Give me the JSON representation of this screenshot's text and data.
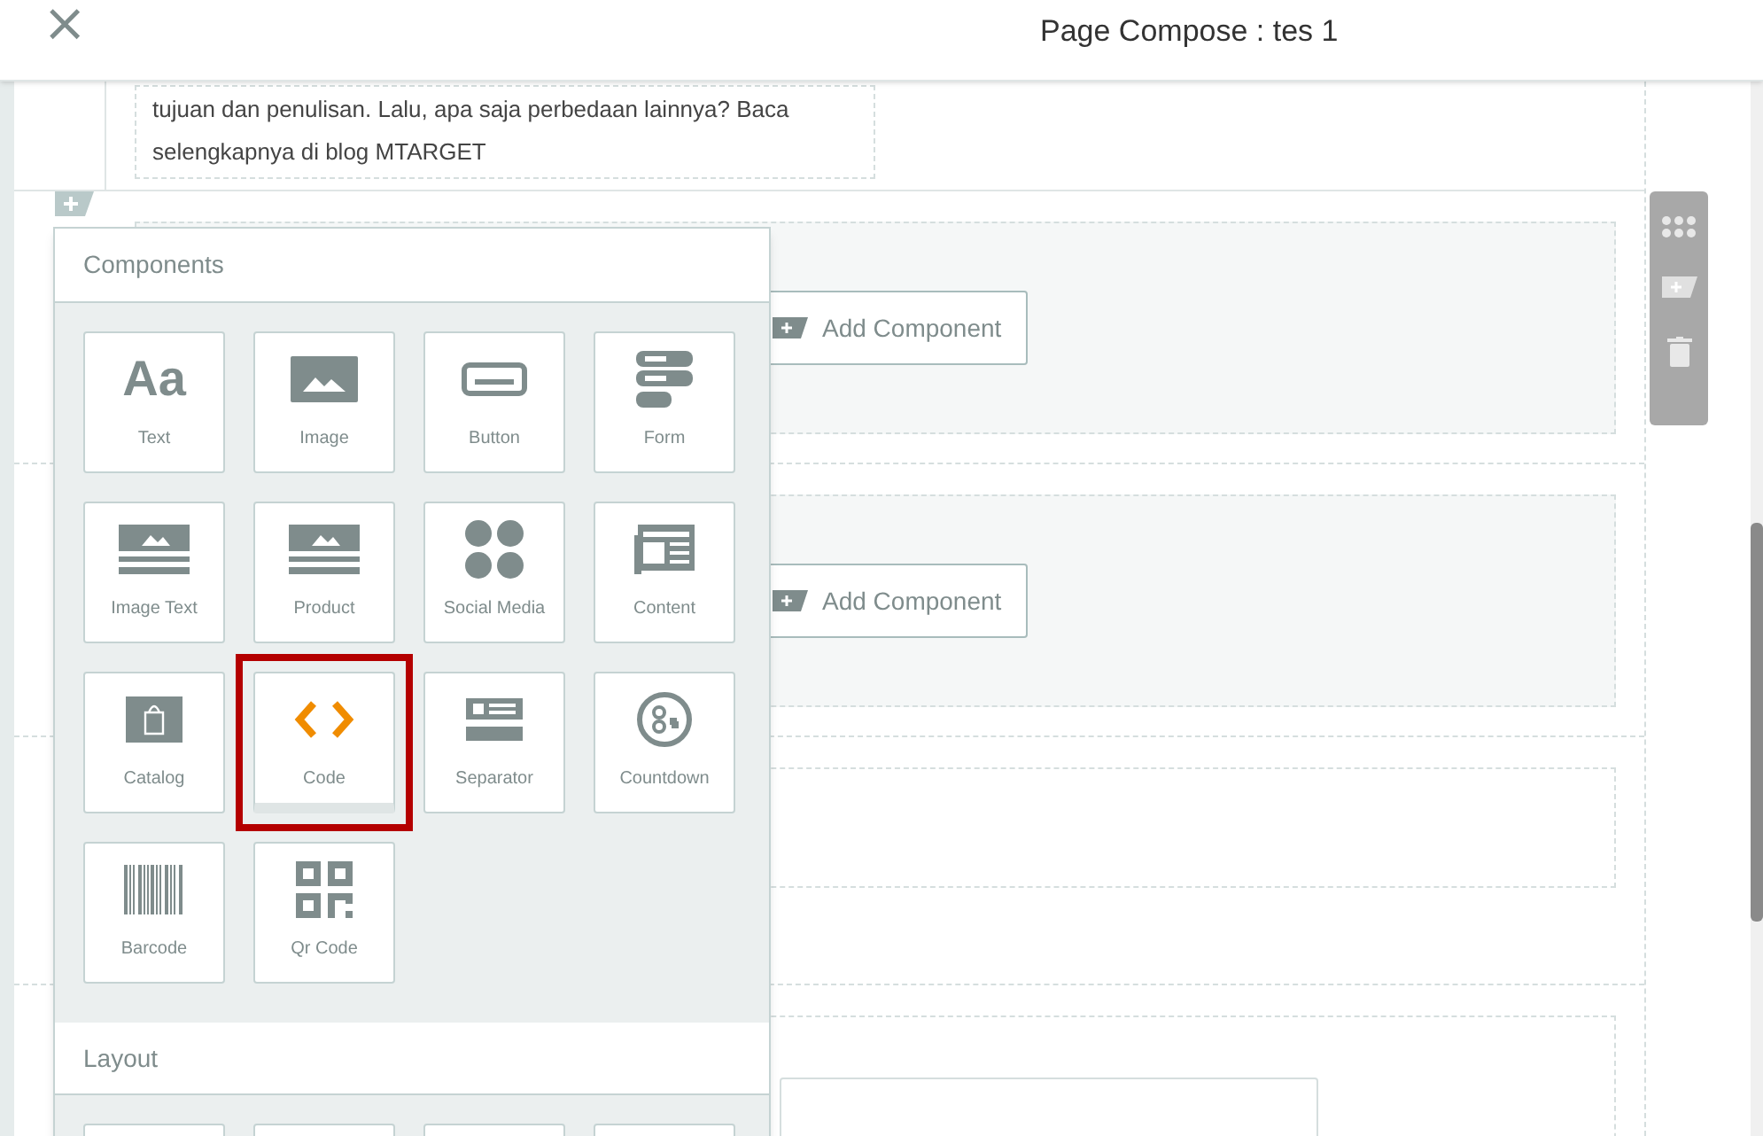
{
  "header": {
    "close": "×",
    "title": "Page Compose : tes 1"
  },
  "text_block": {
    "lines": [
      "tujuan dan penulisan. Lalu, apa saja perbedaan lainnya? Baca",
      "selengkapnya di blog MTARGET"
    ]
  },
  "sections": [
    {
      "kind": "add",
      "button": "Add Component"
    },
    {
      "kind": "add",
      "button": "Add Component"
    },
    {
      "kind": "empty"
    },
    {
      "kind": "field"
    }
  ],
  "popup": {
    "components_title": "Components",
    "components": [
      {
        "kind": "text",
        "label": "Text",
        "glyph": "Aa",
        "selected": false
      },
      {
        "kind": "image",
        "label": "Image",
        "selected": false
      },
      {
        "kind": "button",
        "label": "Button",
        "selected": false
      },
      {
        "kind": "form",
        "label": "Form",
        "selected": false
      },
      {
        "kind": "imagetext",
        "label": "Image Text",
        "selected": false
      },
      {
        "kind": "product",
        "label": "Product",
        "selected": false
      },
      {
        "kind": "social",
        "label": "Social Media",
        "selected": false
      },
      {
        "kind": "content",
        "label": "Content",
        "selected": false
      },
      {
        "kind": "catalog",
        "label": "Catalog",
        "selected": false
      },
      {
        "kind": "code",
        "label": "Code",
        "selected": true
      },
      {
        "kind": "separator",
        "label": "Separator",
        "selected": false
      },
      {
        "kind": "countdown",
        "label": "Countdown",
        "selected": false
      },
      {
        "kind": "barcode",
        "label": "Barcode",
        "selected": false
      },
      {
        "kind": "qrcode",
        "label": "Qr Code",
        "selected": false
      }
    ],
    "layout_title": "Layout"
  }
}
